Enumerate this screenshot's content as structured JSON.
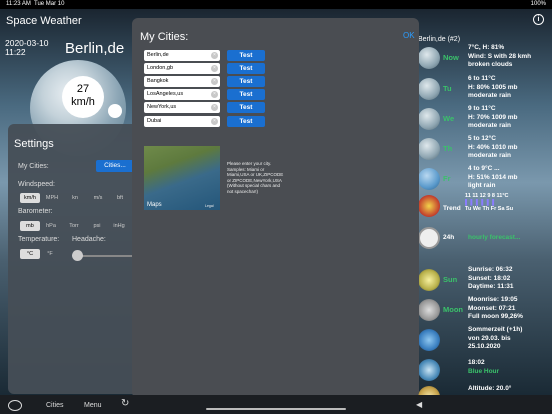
{
  "status_bar": {
    "time": "11:23 AM",
    "date": "Tue Mar 10",
    "right": "100%"
  },
  "app": {
    "title": "Space Weather"
  },
  "main": {
    "date": "2020-03-10",
    "time": "11:22",
    "city": "Berlin,de",
    "wind_value": "27",
    "wind_unit": "km/h"
  },
  "settings": {
    "title": "Settings",
    "my_cities_label": "My Cities:",
    "cities_button": "Cities...",
    "windspeed_label": "Windspeed:",
    "windspeed_options": [
      "km/h",
      "MPH",
      "kn",
      "m/s",
      "bft"
    ],
    "barometer_label": "Barometer:",
    "barometer_options": [
      "mb",
      "hPa",
      "Torr",
      "psi",
      "inHg"
    ],
    "temperature_label": "Temperature:",
    "temperature_options": [
      "°C",
      "°F"
    ],
    "headache_label": "Headache:"
  },
  "modal": {
    "title": "My Cities:",
    "ok": "OK",
    "cities": [
      "Berlin,de",
      "London,gb",
      "Bangkok",
      "LosAngeles,us",
      "NewYork,us",
      "Dubai"
    ],
    "test_label": "Test",
    "map_label": "Maps",
    "map_legal": "Legal",
    "hint": "Please enter your city. Samples: Miami or Miami,USA or UK,ZIPCODE or ZIPCODE,NewYork,USA (Without special chars and not spacechar!)"
  },
  "forecast": {
    "header": "Berlin,de (#2)",
    "rows": [
      {
        "day": "Now",
        "lines": [
          "7°C, H: 81%",
          "Wind: S with 28 kmh",
          "broken clouds"
        ]
      },
      {
        "day": "Tu",
        "lines": [
          "6 to 11°C",
          "H: 80% 1005 mb",
          "moderate rain"
        ]
      },
      {
        "day": "We",
        "lines": [
          "9 to 11°C",
          "H: 70% 1009 mb",
          "moderate rain"
        ]
      },
      {
        "day": "Th",
        "lines": [
          "5 to 12°C",
          "H: 40% 1010 mb",
          "moderate rain"
        ]
      },
      {
        "day": "Fr",
        "lines": [
          "4 to 9°C ...",
          "H: 51% 1014 mb",
          "light rain"
        ]
      }
    ],
    "trend_label": "Trend",
    "trend_values": "11   11   12    9    8   11°C",
    "trend_days": "Tu  We  Th  Fr  Sa  Su",
    "h24_label": "24h",
    "hourly_label": "hourly forecast...",
    "sun": {
      "label": "Sun",
      "lines": [
        "Sunrise: 06:32",
        "Sunset: 18:02",
        "Daytime: 11:31"
      ]
    },
    "moon": {
      "label": "Moon",
      "lines": [
        "Moonrise: 19:05",
        "Moonset: 07:21",
        "Full moon 99,26%"
      ]
    },
    "dst": {
      "lines": [
        "Sommerzeit (+1h)",
        "von 29.03. bis",
        "25.10.2020"
      ]
    },
    "bluehour": {
      "lines": [
        "18:02",
        "Blue Hour"
      ]
    },
    "altitude": {
      "lines": [
        "Altitude: 20.0°"
      ]
    }
  },
  "tabbar": {
    "cities": "Cities",
    "menu": "Menu"
  }
}
